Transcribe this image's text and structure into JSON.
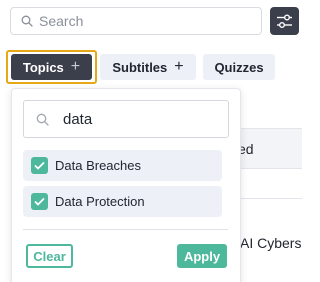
{
  "search": {
    "placeholder": "Search",
    "value": ""
  },
  "toolbar": {
    "filters_icon": "sliders-icon"
  },
  "chips": {
    "topics": {
      "label": "Topics",
      "icon": "plus-icon"
    },
    "subtitles": {
      "label": "Subtitles",
      "icon": "plus-icon"
    },
    "quizzes": {
      "label": "Quizzes"
    }
  },
  "dropdown": {
    "search_value": "data",
    "options": [
      {
        "label": "Data Breaches",
        "checked": true
      },
      {
        "label": "Data Protection",
        "checked": true
      }
    ],
    "clear_label": "Clear",
    "apply_label": "Apply"
  },
  "background_table": {
    "header_fragment": "ed",
    "row_fragment": "AI Cybers"
  },
  "colors": {
    "dark": "#3b3f4c",
    "accent_green": "#4db89c",
    "highlight_outline": "#e6a817",
    "chip_light": "#eef0f8"
  }
}
